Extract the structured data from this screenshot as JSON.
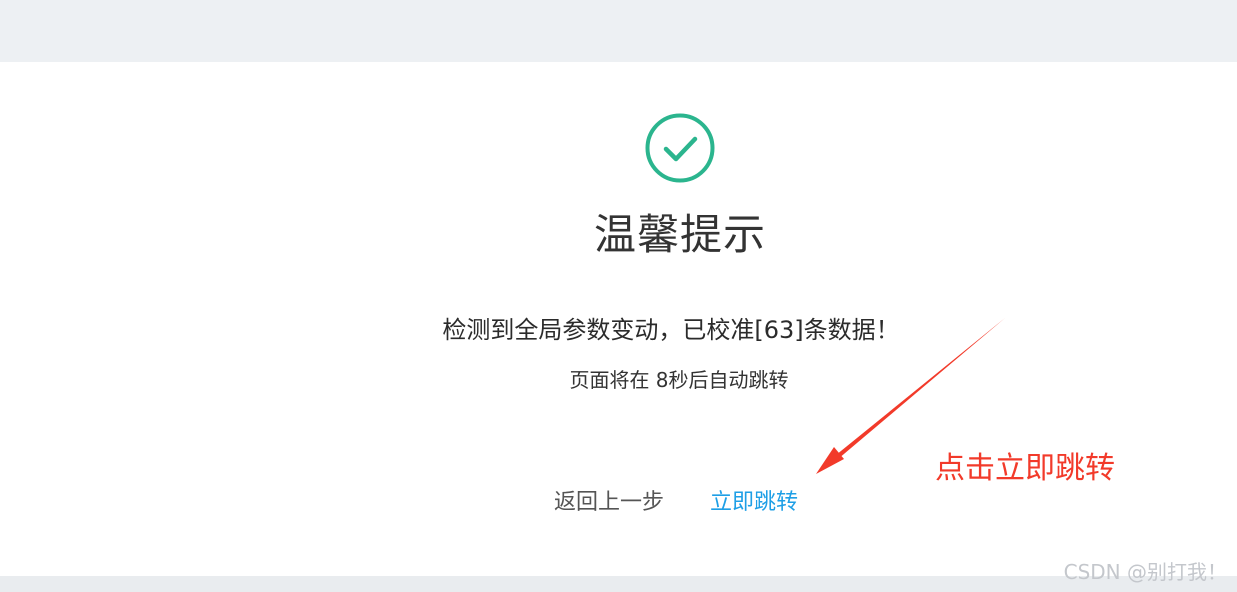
{
  "notice": {
    "title": "温馨提示",
    "message": "检测到全局参数变动，已校准[63]条数据！",
    "countdown": "页面将在 8秒后自动跳转",
    "back_label": "返回上一步",
    "jump_label": "立即跳转",
    "success_icon": "check-circle-icon",
    "success_color": "#2bb58e",
    "link_color": "#1e9fe6"
  },
  "annotation": {
    "text": "点击立即跳转",
    "color": "#f23a2a"
  },
  "watermark": {
    "text": "CSDN @别打我！"
  }
}
